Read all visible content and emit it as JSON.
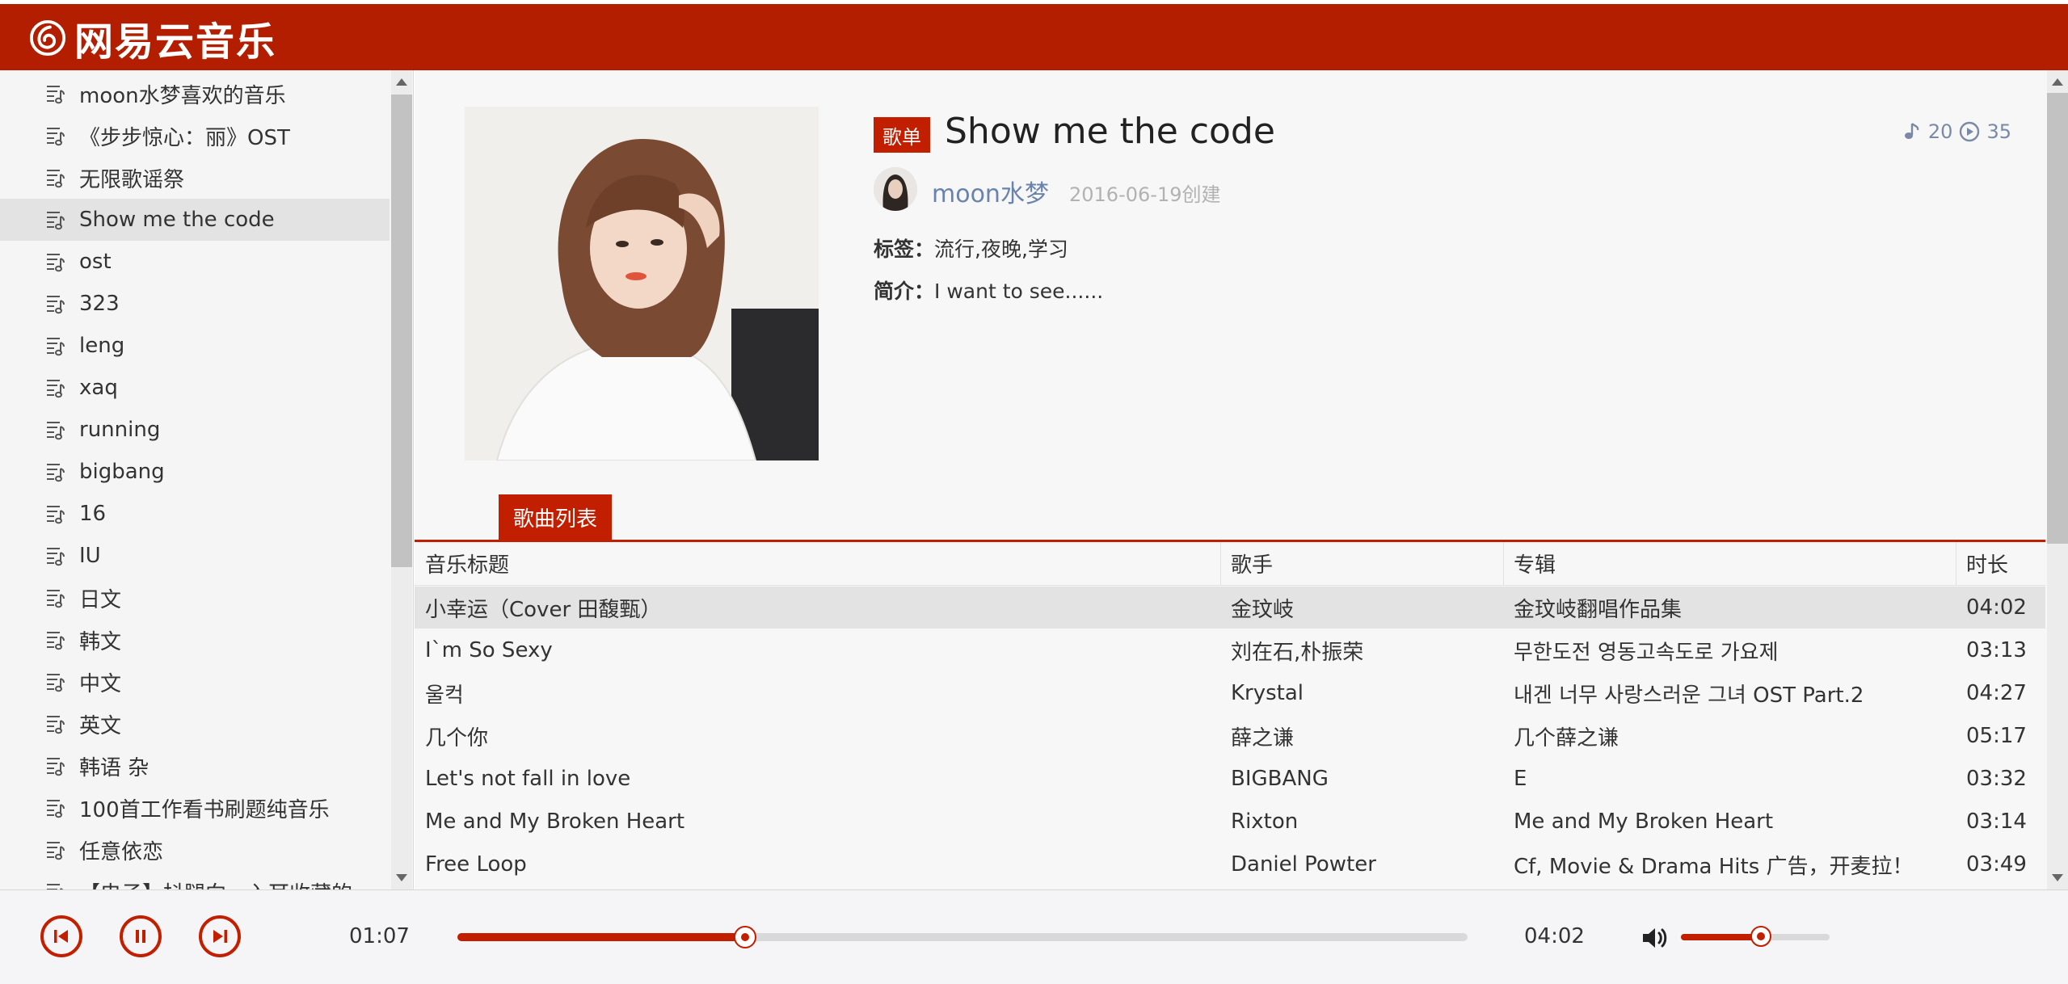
{
  "app": {
    "name": "网易云音乐",
    "accent": "#c11f00"
  },
  "sidebar": {
    "items": [
      "moon水梦喜欢的音乐",
      "《步步惊心：丽》OST",
      "无限歌谣祭",
      "Show me the code",
      "ost",
      "323",
      "leng",
      "xaq",
      "running",
      "bigbang",
      "16",
      "IU",
      "日文",
      "韩文",
      "中文",
      "英文",
      "韩语 杂",
      "100首工作看书刷题纯音乐",
      "任意依恋",
      "【电子】抖腿向，入耳收藏的"
    ],
    "active_index": 3,
    "item_icon": "playlist-icon"
  },
  "playlist": {
    "badge": "歌单",
    "title": "Show me the code",
    "song_count": "20",
    "play_count": "35",
    "creator": "moon水梦",
    "created": "2016-06-19创建",
    "tags_label": "标签：",
    "tags": "流行,夜晚,学习",
    "desc_label": "简介：",
    "desc": "I want to see......"
  },
  "tabs": {
    "song_list": "歌曲列表"
  },
  "table": {
    "headers": [
      "音乐标题",
      "歌手",
      "专辑",
      "时长"
    ],
    "rows": [
      [
        "小幸运（Cover 田馥甄）",
        "金玟岐",
        "金玟岐翻唱作品集",
        "04:02"
      ],
      [
        "I`m So Sexy",
        "刘在石,朴振荣",
        "무한도전 영동고속도로 가요제",
        "03:13"
      ],
      [
        "울컥",
        "Krystal",
        "내겐 너무 사랑스러운 그녀 OST Part.2",
        "04:27"
      ],
      [
        "几个你",
        "薛之谦",
        "几个薛之谦",
        "05:17"
      ],
      [
        "Let's not fall in love",
        "BIGBANG",
        "E",
        "03:32"
      ],
      [
        "Me and My Broken Heart",
        "Rixton",
        "Me and My Broken Heart",
        "03:14"
      ],
      [
        "Free Loop",
        "Daniel Powter",
        "Cf, Movie & Drama Hits 广告，开麦拉！",
        "03:49"
      ]
    ],
    "selected_index": 0
  },
  "player": {
    "current_time": "01:07",
    "total_time": "04:02",
    "progress": 0.285,
    "volume": 0.54
  }
}
